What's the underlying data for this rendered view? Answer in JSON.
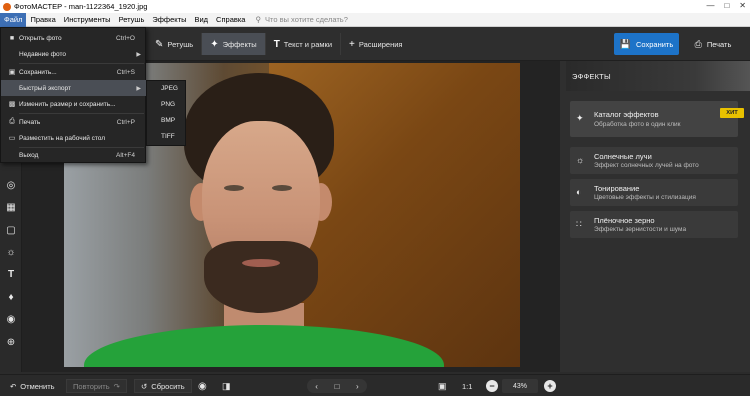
{
  "window": {
    "title": "ФотоМАСТЕР - man-1122364_1920.jpg",
    "controls": [
      "—",
      "□",
      "✕"
    ]
  },
  "menubar": {
    "items": [
      "Файл",
      "Правка",
      "Инструменты",
      "Ретушь",
      "Эффекты",
      "Вид",
      "Справка"
    ],
    "search_placeholder": "Что вы хотите сделать?"
  },
  "toolbar": {
    "tabs": [
      {
        "label": "Ретушь",
        "icon": "brush-icon"
      },
      {
        "label": "Эффекты",
        "icon": "magic-wand-icon"
      },
      {
        "label": "Текст и рамки",
        "icon": "text-icon"
      },
      {
        "label": "Расширения",
        "icon": "plus-icon"
      }
    ],
    "save_label": "Сохранить",
    "print_label": "Печать"
  },
  "file_menu": {
    "items": [
      {
        "label": "Открыть фото",
        "shortcut": "Ctrl+O"
      },
      {
        "label": "Недавние фото",
        "shortcut": ""
      },
      {
        "label": "Сохранить...",
        "shortcut": "Ctrl+S"
      },
      {
        "label": "Быстрый экспорт",
        "shortcut": ""
      },
      {
        "label": "Изменить размер и сохранить...",
        "shortcut": ""
      },
      {
        "label": "Печать",
        "shortcut": "Ctrl+P"
      },
      {
        "label": "Разместить на рабочий стол",
        "shortcut": ""
      },
      {
        "label": "Выход",
        "shortcut": "Alt+F4"
      }
    ],
    "export_submenu": [
      "JPEG",
      "PNG",
      "BMP",
      "TIFF"
    ]
  },
  "effects_panel": {
    "title": "ЭФФЕКТЫ",
    "cards": [
      {
        "title": "Каталог эффектов",
        "subtitle": "Обработка фото в один клик",
        "badge": "ХИТ"
      },
      {
        "title": "Солнечные лучи",
        "subtitle": "Эффект солнечных лучей на фото"
      },
      {
        "title": "Тонирование",
        "subtitle": "Цветовые эффекты и стилизация"
      },
      {
        "title": "Плёночное зерно",
        "subtitle": "Эффекты зернистости и шума"
      }
    ]
  },
  "bottombar": {
    "undo_label": "Отменить",
    "redo_label": "Повторить",
    "reset_label": "Сбросить",
    "ratio_label": "1:1",
    "zoom": "43%"
  },
  "colors": {
    "accent": "#1d73c8",
    "badge": "#e8c100",
    "menu_highlight": "#3d6fb5"
  }
}
